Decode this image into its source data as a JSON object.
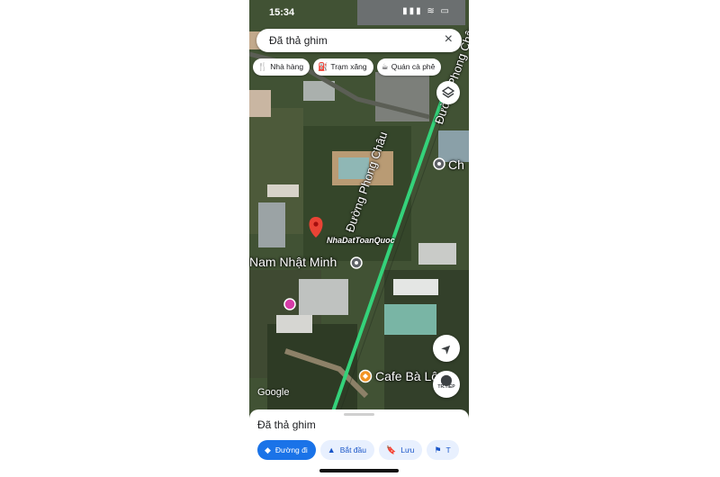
{
  "status_bar": {
    "time": "15:34",
    "icons": "▮▮▮ ≋ ▭"
  },
  "search": {
    "query": "Đã thả ghim",
    "close_icon": "×"
  },
  "category_chips": [
    {
      "label": "Nhà hàng",
      "icon": "fork-knife-icon",
      "glyph": "🍴"
    },
    {
      "label": "Trạm xăng",
      "icon": "gas-station-icon",
      "glyph": "⛽"
    },
    {
      "label": "Quán cà phê",
      "icon": "coffee-cup-icon",
      "glyph": "☕"
    }
  ],
  "map": {
    "road_label": "Đường Phong Châu",
    "places": {
      "nam_nhat_minh": "Nam Nhật Minh",
      "cafe": "Cafe Bà Lộ",
      "partial_top_right": "Ch"
    },
    "watermark": "NhaDatToanQuoc",
    "attribution": "Google"
  },
  "controls": {
    "continue_label": "TR.TIẾP"
  },
  "sheet": {
    "title": "Đã thả ghim",
    "actions": [
      {
        "label": "Đường đi",
        "icon": "directions-icon",
        "glyph": "◆"
      },
      {
        "label": "Bắt đầu",
        "icon": "navigation-arrow-icon",
        "glyph": "▲"
      },
      {
        "label": "Lưu",
        "icon": "bookmark-icon",
        "glyph": "🔖"
      },
      {
        "label": "T",
        "icon": "flag-icon",
        "glyph": "⚑"
      }
    ]
  },
  "colors": {
    "accent": "#1a73e8",
    "pin": "#ea4335",
    "road": "#34d27a"
  }
}
